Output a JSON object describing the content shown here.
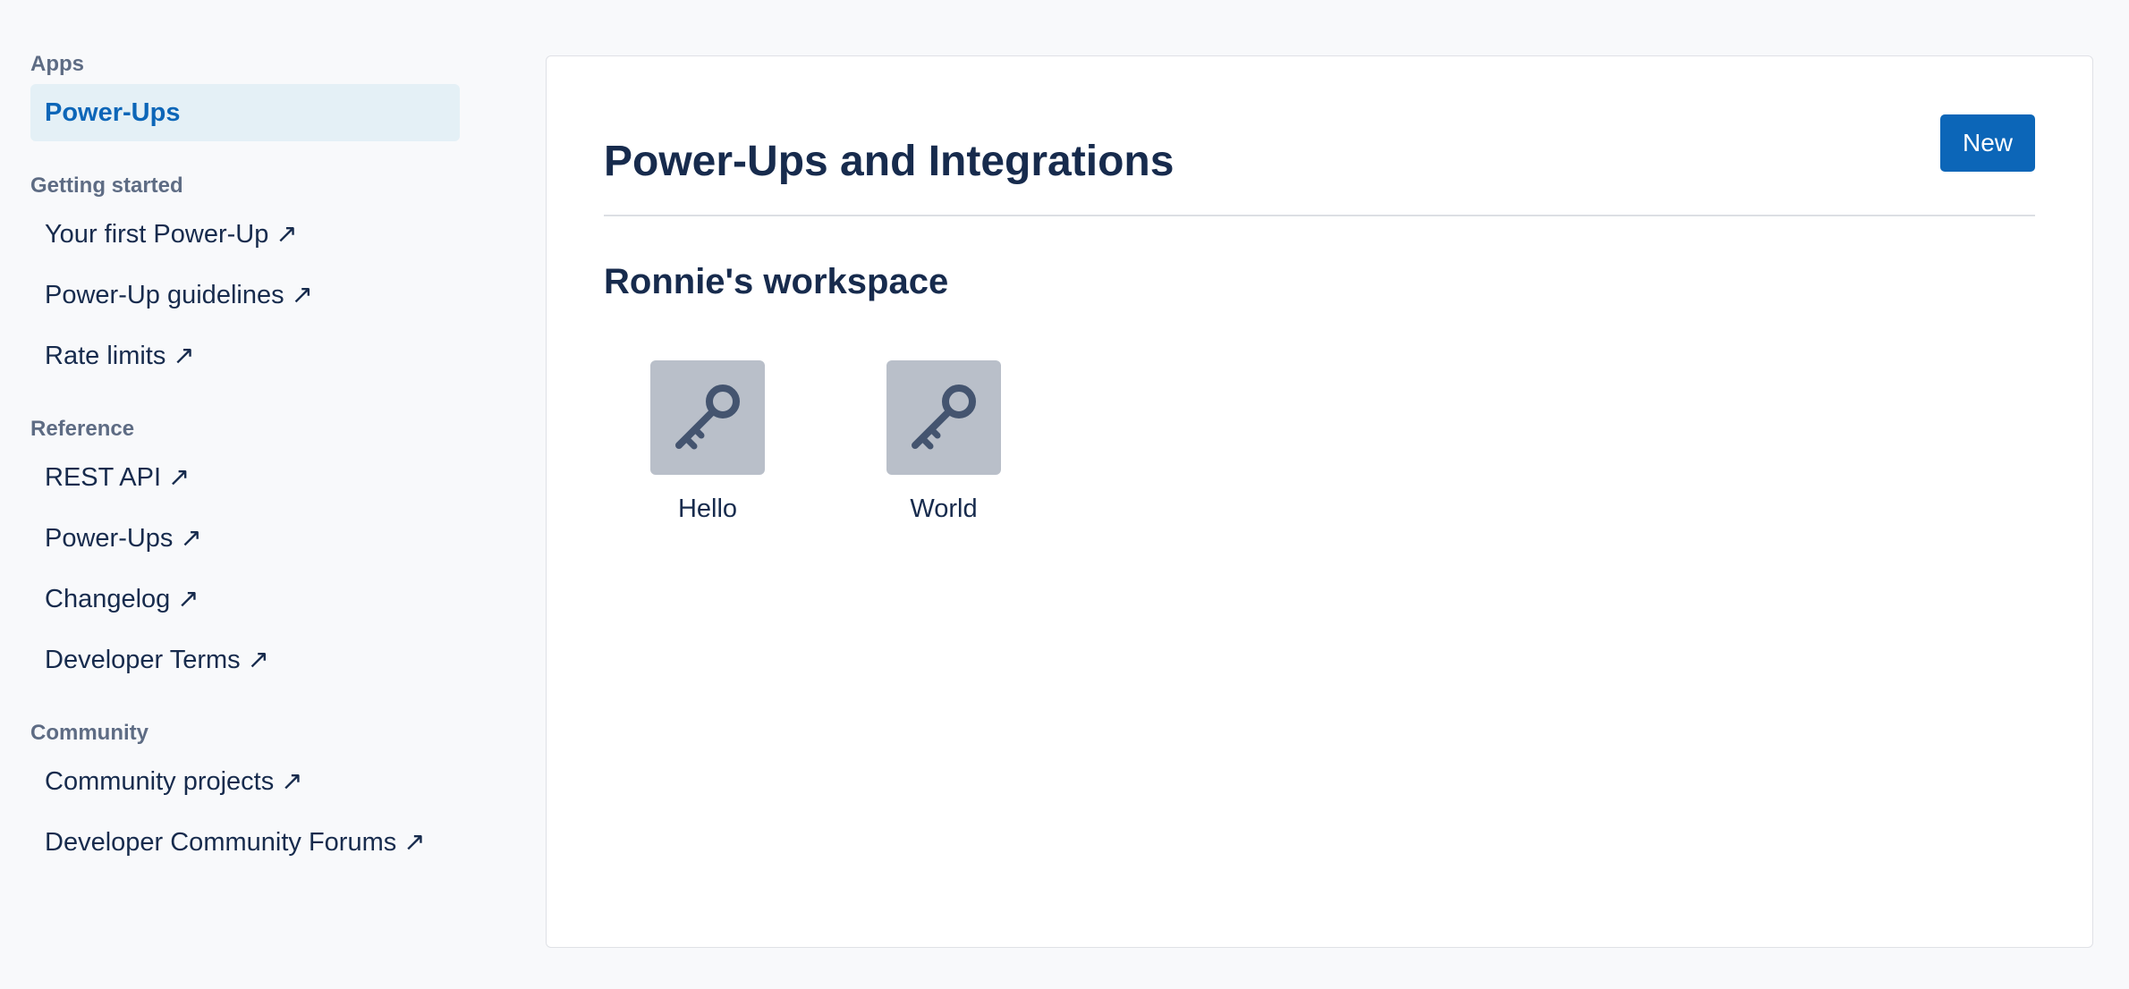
{
  "sidebar": {
    "sections": [
      {
        "heading": "Apps",
        "items": [
          {
            "label": "Power-Ups",
            "active": true
          }
        ]
      },
      {
        "heading": "Getting started",
        "items": [
          {
            "label": "Your first Power-Up",
            "arrow": "↗"
          },
          {
            "label": "Power-Up guidelines",
            "arrow": "↗"
          },
          {
            "label": "Rate limits",
            "arrow": "↗"
          }
        ]
      },
      {
        "heading": "Reference",
        "items": [
          {
            "label": "REST API",
            "arrow": "↗"
          },
          {
            "label": "Power-Ups",
            "arrow": "↗"
          },
          {
            "label": "Changelog",
            "arrow": "↗"
          },
          {
            "label": "Developer Terms",
            "arrow": "↗"
          }
        ]
      },
      {
        "heading": "Community",
        "items": [
          {
            "label": "Community projects",
            "arrow": "↗"
          },
          {
            "label": "Developer Community Forums",
            "arrow": "↗"
          }
        ]
      }
    ]
  },
  "main": {
    "title": "Power-Ups and Integrations",
    "new_button_label": "New",
    "workspace_title": "Ronnie's workspace",
    "apps": [
      {
        "name": "Hello",
        "icon": "key-icon"
      },
      {
        "name": "World",
        "icon": "key-icon"
      }
    ]
  },
  "colors": {
    "accent": "#0c66b8",
    "active_bg": "#e4f0f6",
    "icon_tile_bg": "#b9bfc9",
    "icon_fg": "#44546f"
  }
}
